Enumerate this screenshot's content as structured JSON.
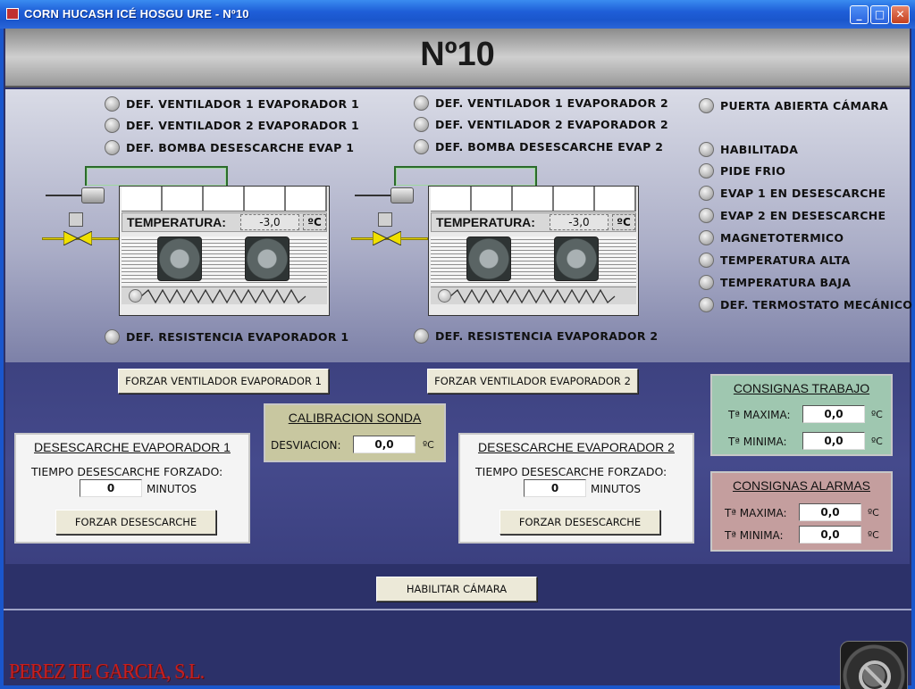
{
  "window": {
    "title": "CORN HUCASH  ICÉ HOSGU URE - Nº10"
  },
  "header": {
    "number": "Nº10"
  },
  "evap1": {
    "alarms": [
      "DEF. VENTILADOR 1 EVAPORADOR 1",
      "DEF. VENTILADOR 2 EVAPORADOR 1",
      "DEF. BOMBA DESESCARCHE EVAP 1"
    ],
    "resistencia": "DEF. RESISTENCIA EVAPORADOR 1",
    "temp_label": "TEMPERATURA:",
    "temp_value": "-3,0",
    "temp_unit": "ºC",
    "force_fan_btn": "FORZAR VENTILADOR EVAPORADOR 1"
  },
  "evap2": {
    "alarms": [
      "DEF. VENTILADOR 1 EVAPORADOR 2",
      "DEF. VENTILADOR 2 EVAPORADOR 2",
      "DEF. BOMBA DESESCARCHE EVAP 2"
    ],
    "resistencia": "DEF. RESISTENCIA EVAPORADOR 2",
    "temp_label": "TEMPERATURA:",
    "temp_value": "-3,0",
    "temp_unit": "ºC",
    "force_fan_btn": "FORZAR VENTILADOR EVAPORADOR 2"
  },
  "status": {
    "door": "PUERTA ABIERTA CÁMARA",
    "items": [
      "HABILITADA",
      "PIDE FRIO",
      "EVAP 1 EN DESESCARCHE",
      "EVAP 2 EN DESESCARCHE",
      "MAGNETOTERMICO",
      "TEMPERATURA ALTA",
      "TEMPERATURA BAJA",
      "DEF. TERMOSTATO MECÁNICO"
    ]
  },
  "defrost1": {
    "title": "DESESCARCHE EVAPORADOR 1",
    "time_label": "TIEMPO DESESCARCHE FORZADO:",
    "value": "0",
    "unit": "MINUTOS",
    "button": "FORZAR DESESCARCHE"
  },
  "defrost2": {
    "title": "DESESCARCHE EVAPORADOR 2",
    "time_label": "TIEMPO DESESCARCHE FORZADO:",
    "value": "0",
    "unit": "MINUTOS",
    "button": "FORZAR DESESCARCHE"
  },
  "calibration": {
    "title": "CALIBRACION SONDA",
    "label": "DESVIACION:",
    "value": "0,0",
    "unit": "ºC"
  },
  "consignas_trabajo": {
    "title": "CONSIGNAS TRABAJO",
    "max_label": "Tª MAXIMA:",
    "max_value": "0,0",
    "min_label": "Tª MINIMA:",
    "min_value": "0,0",
    "unit": "ºC"
  },
  "consignas_alarmas": {
    "title": "CONSIGNAS ALARMAS",
    "max_label": "Tª MAXIMA:",
    "max_value": "0,0",
    "min_label": "Tª MINIMA:",
    "min_value": "0,0",
    "unit": "ºC"
  },
  "footer": {
    "enable_btn": "HABILITAR CÁMARA",
    "company": "PEREZ TE GARCIA, S.L."
  },
  "colors": {
    "trabajo_bg": "#9fc7b0",
    "alarmas_bg": "#c49e9e",
    "calib_bg": "#c8c7a0",
    "panel_bg": "#f4f4f4",
    "logo": "#c71f1f"
  }
}
